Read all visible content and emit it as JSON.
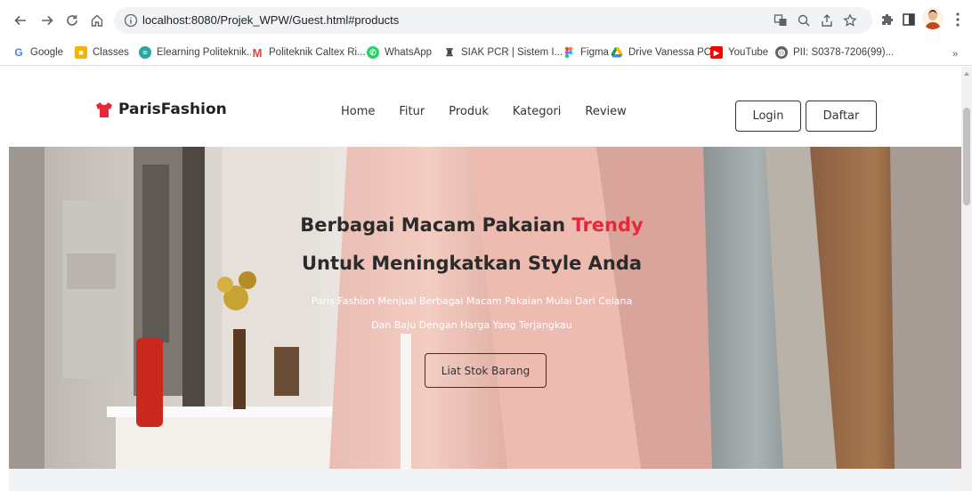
{
  "browser": {
    "url": "localhost:8080/Projek_WPW/Guest.html#products",
    "bookmarks": [
      {
        "label": "Google",
        "icon": "google-icon",
        "color": "#4285f4"
      },
      {
        "label": "Classes",
        "icon": "classroom-icon",
        "color": "#f4b400"
      },
      {
        "label": "Elearning Politeknik...",
        "icon": "elearning-icon",
        "color": "#2aa6a1"
      },
      {
        "label": "Politeknik Caltex Ri...",
        "icon": "gmail-icon",
        "color": "#ea4335"
      },
      {
        "label": "WhatsApp",
        "icon": "whatsapp-icon",
        "color": "#25d366"
      },
      {
        "label": "SIAK PCR | Sistem I...",
        "icon": "siak-icon",
        "color": "#5f6368"
      },
      {
        "label": "Figma",
        "icon": "figma-icon",
        "color": "#f24e1e"
      },
      {
        "label": "Drive Vanessa PCR",
        "icon": "drive-icon",
        "color": "#0f9d58"
      },
      {
        "label": "YouTube",
        "icon": "youtube-icon",
        "color": "#ff0000"
      },
      {
        "label": "PII: S0378-7206(99)...",
        "icon": "globe-icon",
        "color": "#5f6368"
      }
    ],
    "more": "»"
  },
  "site": {
    "brand": "ParisFashion",
    "brand_color": "#e8283a",
    "nav": [
      "Home",
      "Fitur",
      "Produk",
      "Kategori",
      "Review"
    ],
    "login": "Login",
    "register": "Daftar"
  },
  "hero": {
    "title_line1": "Berbagai Macam Pakaian ",
    "title_accent": "Trendy",
    "title_line2": "Untuk Meningkatkan Style Anda",
    "subtitle_line1": "Paris Fashion Menjual Berbagai Macam Pakaian Mulai Dari Celana",
    "subtitle_line2": "Dan Baju Dengan Harga Yang Terjangkau",
    "cta": "Liat Stok Barang"
  }
}
